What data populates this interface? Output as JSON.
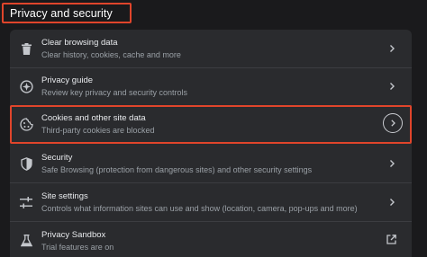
{
  "section": {
    "title": "Privacy and security"
  },
  "rows": [
    {
      "label": "Clear browsing data",
      "sublabel": "Clear history, cookies, cache and more",
      "icon": "trash-icon",
      "action": "chevron-right-icon"
    },
    {
      "label": "Privacy guide",
      "sublabel": "Review key privacy and security controls",
      "icon": "compass-icon",
      "action": "chevron-right-icon"
    },
    {
      "label": "Cookies and other site data",
      "sublabel": "Third-party cookies are blocked",
      "icon": "cookie-icon",
      "action": "chevron-right-circle-icon"
    },
    {
      "label": "Security",
      "sublabel": "Safe Browsing (protection from dangerous sites) and other security settings",
      "icon": "shield-icon",
      "action": "chevron-right-icon"
    },
    {
      "label": "Site settings",
      "sublabel": "Controls what information sites can use and show (location, camera, pop-ups and more)",
      "icon": "sliders-icon",
      "action": "chevron-right-icon"
    },
    {
      "label": "Privacy Sandbox",
      "sublabel": "Trial features are on",
      "icon": "flask-icon",
      "action": "open-external-icon"
    }
  ],
  "colors": {
    "background": "#1a1a1c",
    "card": "#2a2b2e",
    "highlight_border": "#e0452b",
    "primary_text": "#e8eaed",
    "secondary_text": "#9aa0a6"
  }
}
